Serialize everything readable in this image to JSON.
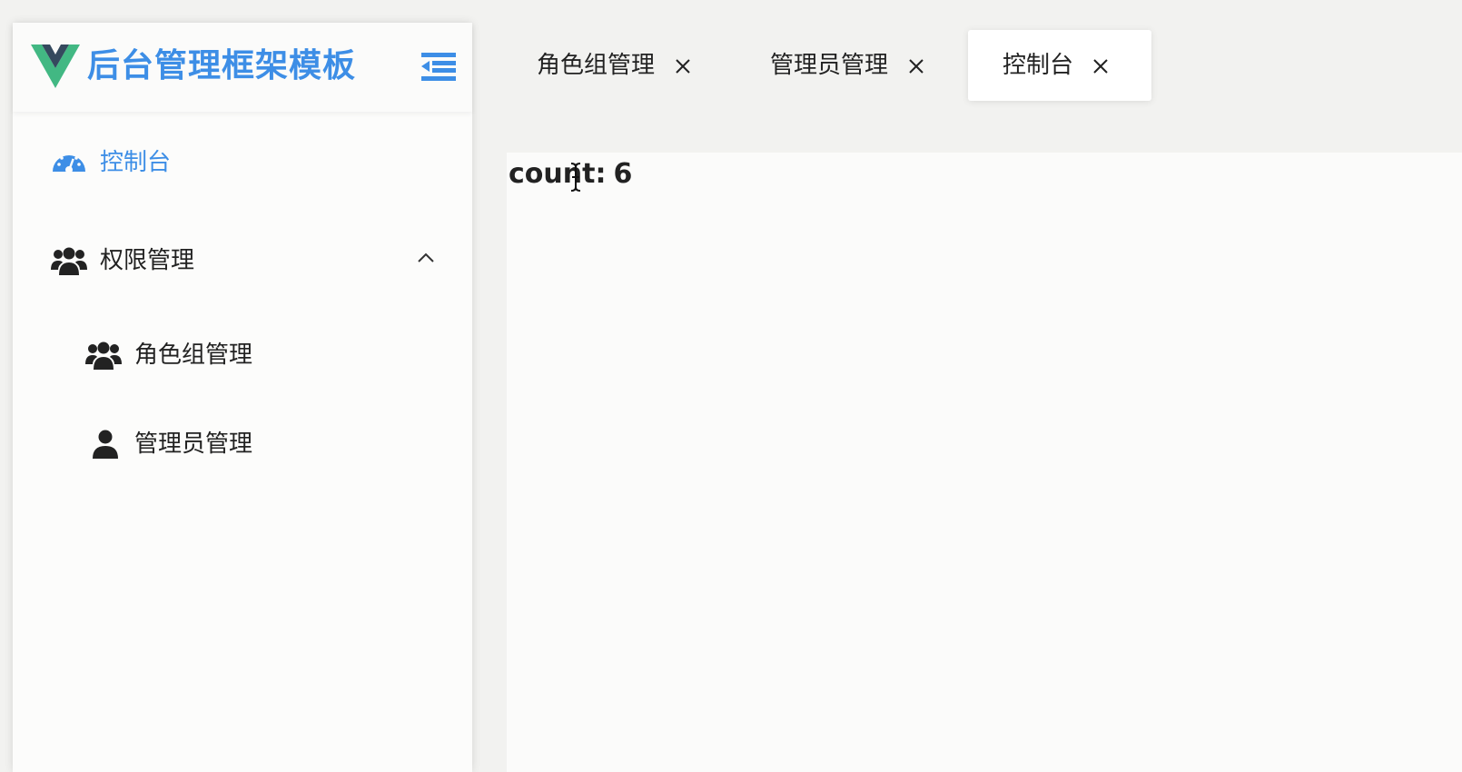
{
  "brand": {
    "title": "后台管理框架模板",
    "logo_icon": "vue-logo-icon",
    "collapse_icon": "menu-fold-icon",
    "title_color": "#3d8ee6",
    "logo_colors": [
      "#42b883",
      "#35495e"
    ]
  },
  "sidebar": {
    "items": [
      {
        "label": "控制台",
        "icon": "dashboard-icon",
        "active": true
      },
      {
        "label": "权限管理",
        "icon": "users-icon",
        "expanded": true,
        "chevron_icon": "chevron-up-icon",
        "children": [
          {
            "label": "角色组管理",
            "icon": "users-icon"
          },
          {
            "label": "管理员管理",
            "icon": "user-icon"
          }
        ]
      }
    ]
  },
  "tabs": [
    {
      "label": "角色组管理",
      "close_icon": "close-icon",
      "active": false
    },
    {
      "label": "管理员管理",
      "close_icon": "close-icon",
      "active": false
    },
    {
      "label": "控制台",
      "close_icon": "close-icon",
      "active": true
    }
  ],
  "main": {
    "count_label": "count:",
    "count_value": "6"
  }
}
